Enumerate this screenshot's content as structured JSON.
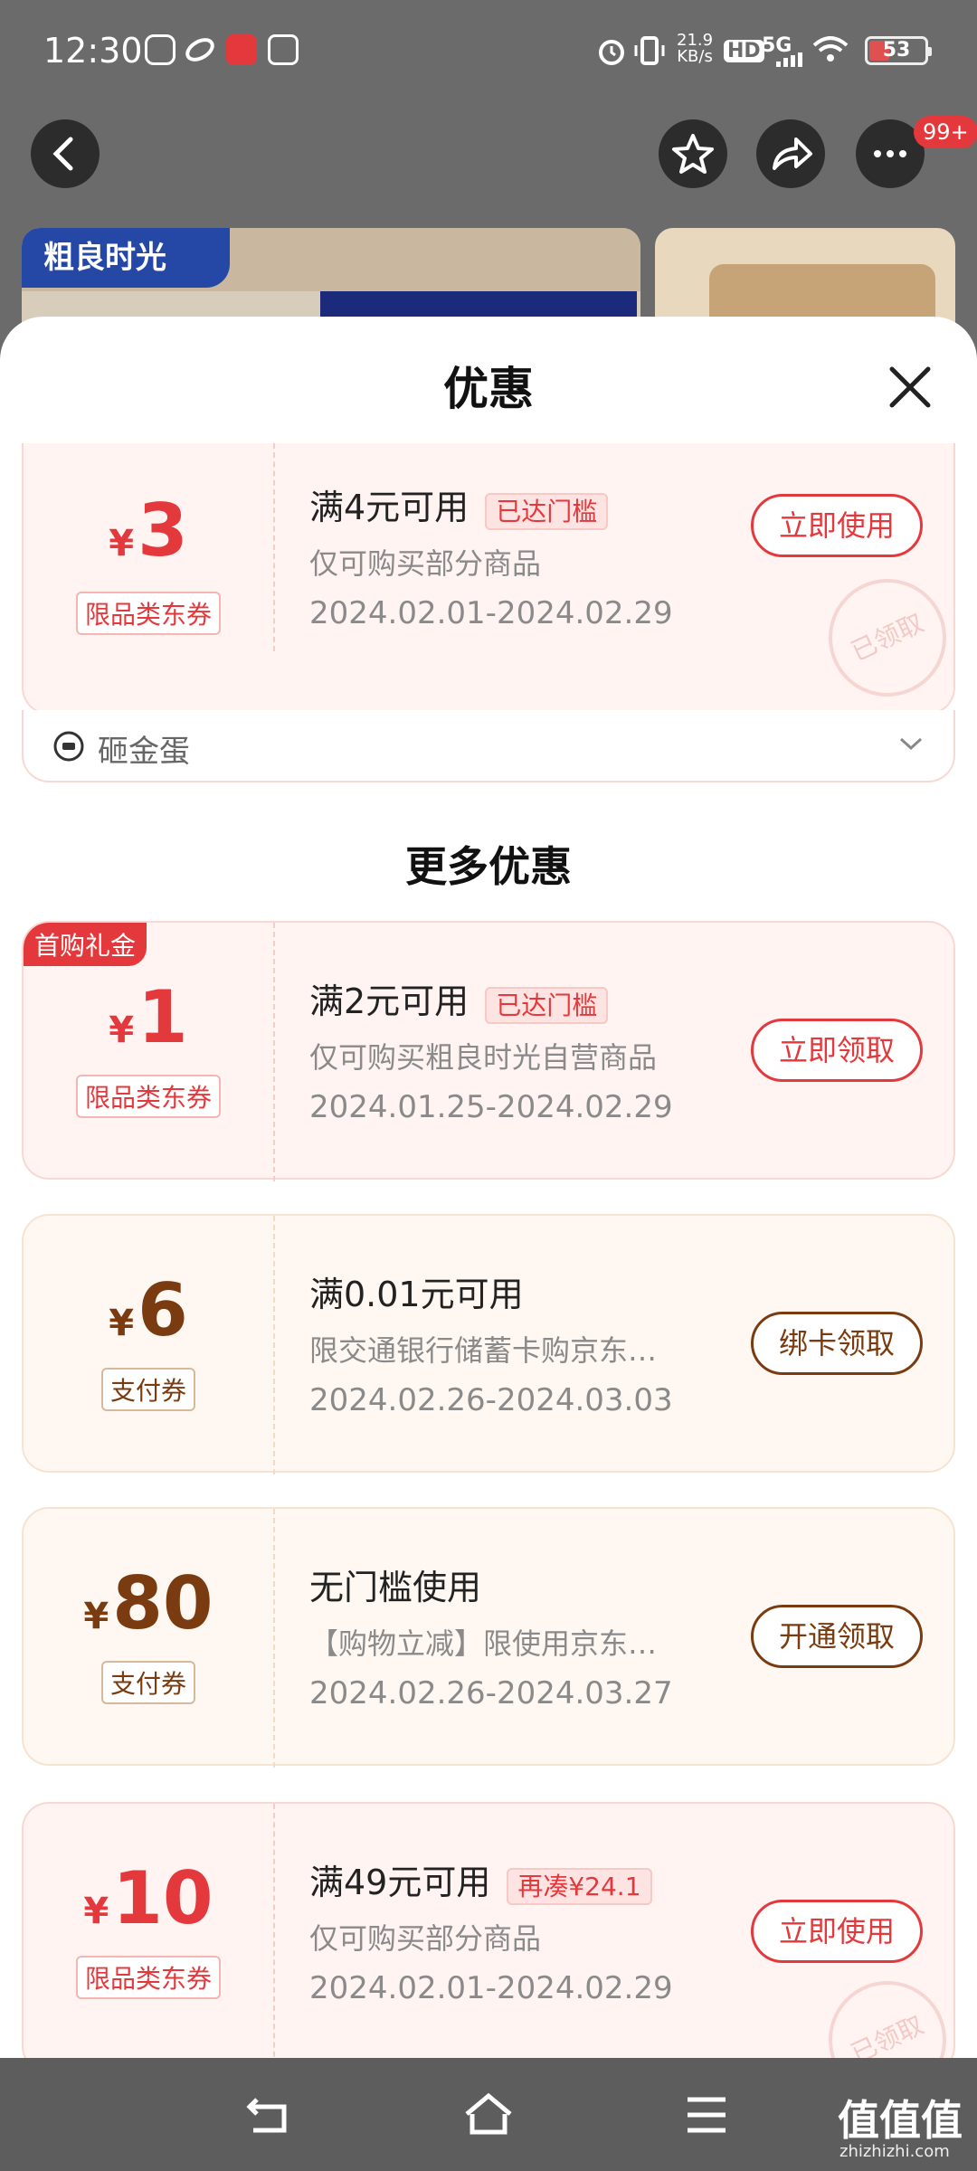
{
  "status_bar": {
    "time": "12:30",
    "net_speed": "21.9",
    "net_unit": "KB/s",
    "hd": "HD",
    "signal": "5G",
    "battery": "53"
  },
  "header": {
    "more_badge": "99+"
  },
  "banner": {
    "brand_logo": "粗良时光"
  },
  "sheet": {
    "title": "优惠",
    "top_coupon": {
      "currency": "¥",
      "amount": "3",
      "type": "限品类东券",
      "condition": "满4元可用",
      "tag": "已达门槛",
      "desc": "仅可购买部分商品",
      "date": "2024.02.01-2024.02.29",
      "button": "立即使用",
      "stamp": "已领取"
    },
    "sub_item": {
      "label": "砸金蛋"
    },
    "more_title": "更多优惠",
    "coupons": [
      {
        "badge": "首购礼金",
        "currency": "¥",
        "amount": "1",
        "type": "限品类东券",
        "condition": "满2元可用",
        "tag": "已达门槛",
        "desc": "仅可购买粗良时光自营商品",
        "date": "2024.01.25-2024.02.29",
        "button": "立即领取"
      },
      {
        "currency": "¥",
        "amount": "6",
        "type": "支付券",
        "condition": "满0.01元可用",
        "desc": "限交通银行储蓄卡购京东…",
        "date": "2024.02.26-2024.03.03",
        "button": "绑卡领取"
      },
      {
        "currency": "¥",
        "amount": "80",
        "type": "支付券",
        "condition": "无门槛使用",
        "desc": "【购物立减】限使用京东…",
        "date": "2024.02.26-2024.03.27",
        "button": "开通领取"
      },
      {
        "currency": "¥",
        "amount": "10",
        "type": "限品类东券",
        "condition": "满49元可用",
        "tag": "再凑¥24.1",
        "desc": "仅可购买部分商品",
        "date": "2024.02.01-2024.02.29",
        "button": "立即使用",
        "stamp": "已领取"
      }
    ]
  },
  "watermark": {
    "text": "值值值",
    "sub": "zhizhizhi.com"
  },
  "colors": {
    "red": "#e4393c",
    "brown": "#7a3b10"
  }
}
